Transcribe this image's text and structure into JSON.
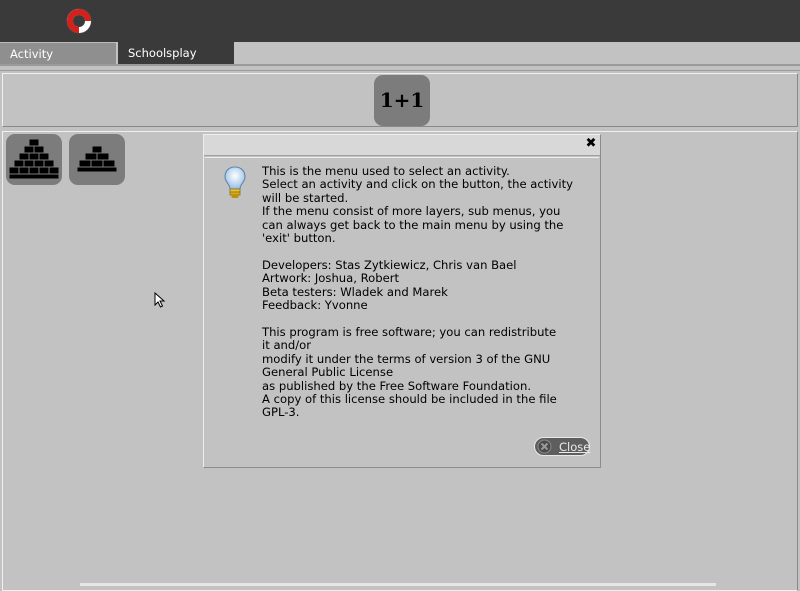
{
  "tabs": [
    {
      "label": "Activity",
      "active": true
    },
    {
      "label": "Schoolsplay",
      "active": false
    }
  ],
  "header": {
    "logo_icon": "lifebuoy-icon"
  },
  "activities": {
    "title_tile": "1+1",
    "buttons": [
      {
        "icon": "pyramid-large-icon"
      },
      {
        "icon": "pyramid-small-icon"
      }
    ]
  },
  "dialog": {
    "close_x": "✖",
    "icon": "lightbulb-icon",
    "lines": [
      "This is the menu used to select an activity.",
      "Select an activity and click on the button, the activity",
      "will be started.",
      "If the menu consist of more layers, sub menus, you",
      "can always get back to the main menu by using the",
      "'exit' button.",
      "",
      "Developers: Stas Zytkiewicz, Chris van Bael",
      "Artwork: Joshua, Robert",
      "Beta testers: Wladek and Marek",
      "Feedback: Yvonne",
      "",
      "This program is free software; you can redistribute",
      "it and/or",
      "modify it under the terms of version 3 of the GNU",
      "General Public License",
      "as published by the Free Software Foundation.",
      "A copy of this license should be included in the file",
      "GPL-3."
    ],
    "close_button_label": "Close"
  },
  "colors": {
    "background": "#c2c2c2",
    "topbar": "#3a3a3a",
    "tile": "#7c7c7c"
  }
}
